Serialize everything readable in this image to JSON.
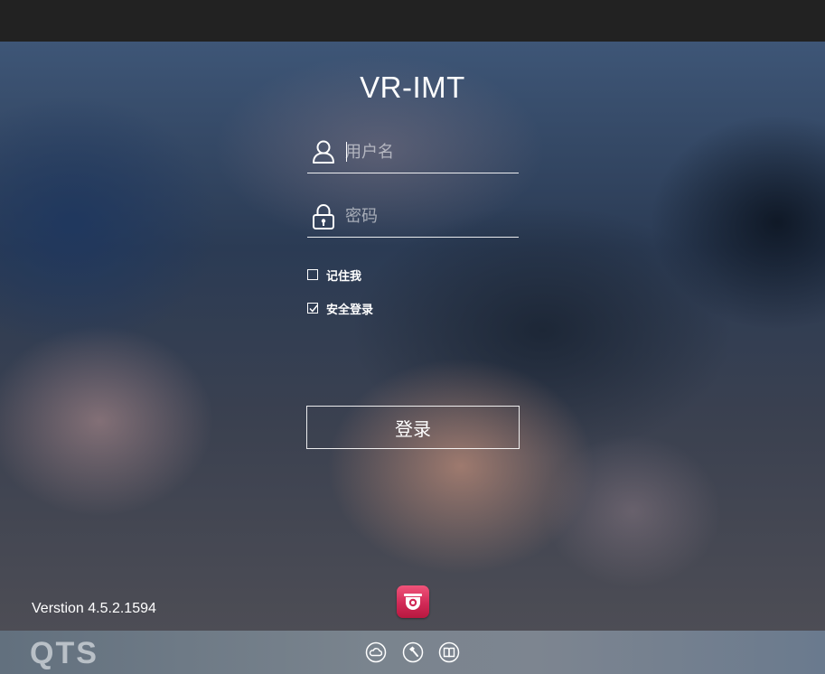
{
  "app": {
    "title": "VR-IMT"
  },
  "login_form": {
    "username_placeholder": "用户名",
    "password_placeholder": "密码",
    "remember_me_label": "记住我",
    "remember_me_checked": false,
    "secure_login_label": "安全登录",
    "secure_login_checked": true,
    "submit_label": "登录"
  },
  "footer": {
    "version_text": "Verstion 4.5.2.1594",
    "brand_text": "QTS",
    "app_icon": "camera-surveillance-icon",
    "bottom_icons": [
      "cloud-icon",
      "hammer-icon",
      "book-icon"
    ]
  },
  "colors": {
    "app_icon_accent": "#d12a57",
    "top_bar": "#222222",
    "bottom_bar": "#7a848e"
  }
}
